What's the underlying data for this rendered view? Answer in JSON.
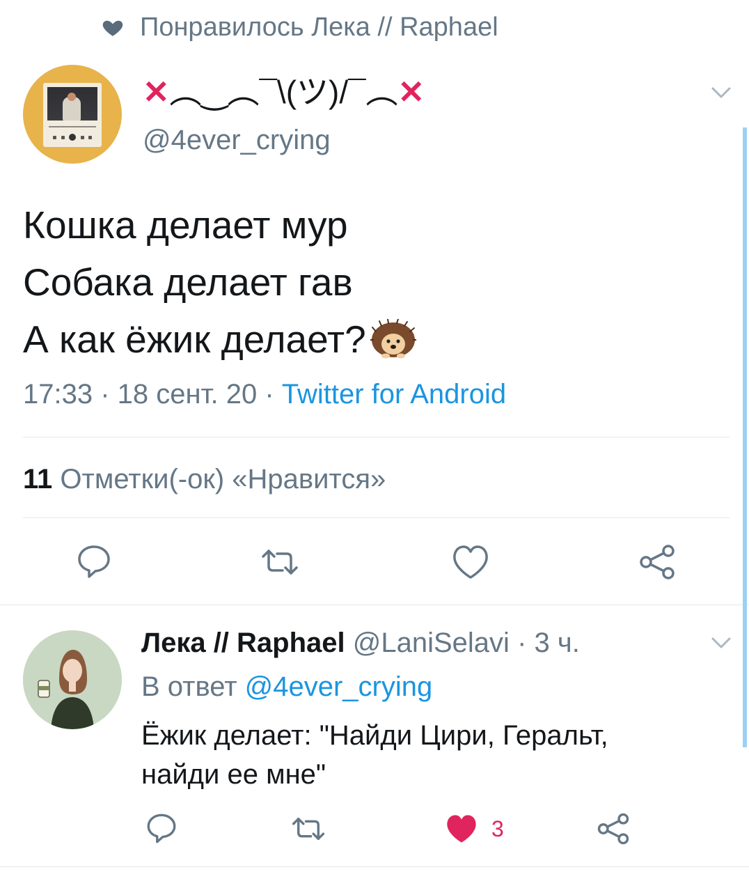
{
  "liked_by": {
    "icon": "heart-icon",
    "text": "Понравилось Лека // Raphael"
  },
  "tweet": {
    "avatar_icon": "music-player-avatar",
    "display_name_left": "✕",
    "display_name_middle": "︵‿︵¯\\(ツ)/¯︵",
    "display_name_right": "✕",
    "handle": "@4ever_crying",
    "text_lines": [
      "Кошка делает мур",
      "Собака делает гав",
      "А как ёжик делает?"
    ],
    "emoji": "hedgehog-emoji",
    "time": "17:33",
    "date": "18 сент. 20",
    "client": "Twitter for Android",
    "separator": " · ",
    "likes_count": "11",
    "likes_label": "Отметки(-ок) «Нравится»",
    "actions": [
      "reply-icon",
      "retweet-icon",
      "like-icon",
      "share-icon"
    ]
  },
  "reply": {
    "name": "Лека // Raphael",
    "handle": "@LaniSelavi",
    "time": "3 ч.",
    "separator": " · ",
    "reply_to_prefix": "В ответ ",
    "reply_to_mention": "@4ever_crying",
    "text_line1": "Ёжик делает: \"Найди Цири, Геральт,",
    "text_line2": "найди ее мне\"",
    "like_count": "3",
    "liked": true
  },
  "colors": {
    "accent_blue": "#1b95e0",
    "muted_gray": "#657786",
    "like_red": "#e0245e",
    "thread_line": "#9dd1f2",
    "avatar_yellow": "#e7b34a"
  }
}
